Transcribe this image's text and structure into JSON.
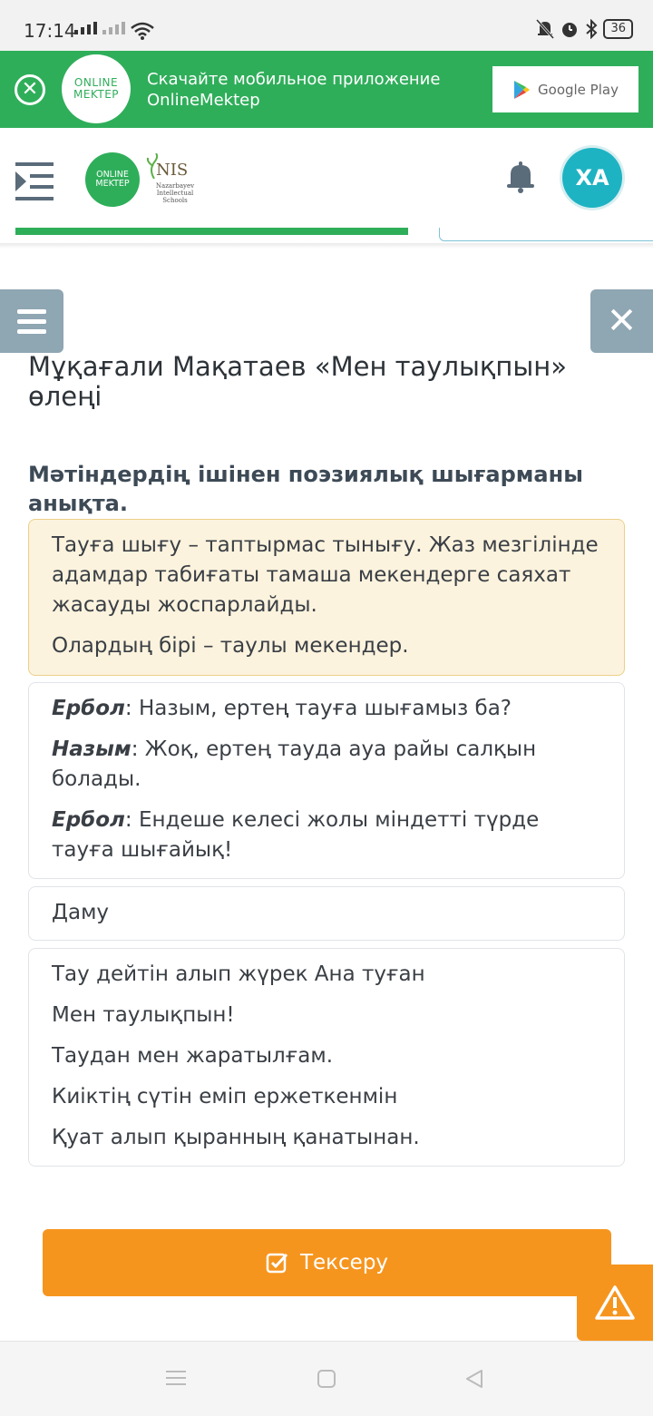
{
  "status_bar": {
    "time": "17:14",
    "battery": "36"
  },
  "banner": {
    "logo_line1": "ONLINE",
    "logo_line2": "MEKTEP",
    "text_line1": "Скачайте мобильное приложение",
    "text_line2": "OnlineMektep",
    "store_label": "Google Play"
  },
  "header": {
    "logo_line1": "ONLINE",
    "logo_line2": "MEKTEP",
    "nis_big": "NIS",
    "nis_small": "Nazarbayev Intellectual Schools",
    "avatar_initials": "ХА"
  },
  "lesson": {
    "title": "Мұқағали Мақатаев «Мен таулықпын» өлеңі",
    "question": "Мәтіндердің ішінен поэзиялық шығарманы анықта."
  },
  "options": [
    {
      "selected": true,
      "paragraphs": [
        "Тауға шығу – таптырмас тынығу. Жаз мезгілінде адамдар табиғаты тамаша мекендерге саяхат жасауды жоспарлайды.",
        "Олардың бірі – таулы мекендер."
      ]
    },
    {
      "selected": false,
      "lines": [
        {
          "speaker": "Ербол",
          "text": ": Назым, ертең тауға шығамыз ба?"
        },
        {
          "speaker": "Назым",
          "text": ": Жоқ, ертең тауда ауа райы салқын болады."
        },
        {
          "speaker": "Ербол",
          "text": ": Ендеше келесі жолы міндетті түрде тауға шығайық!"
        }
      ]
    },
    {
      "selected": false,
      "paragraphs": [
        "Даму"
      ]
    },
    {
      "selected": false,
      "paragraphs": [
        "Тау дейтін алып жүрек Ана туған",
        "Мен таулықпын!",
        "Таудан мен жаратылғам.",
        "Киіктің сүтін еміп ержеткенмін",
        "Қуат алып қыранның қанатынан."
      ]
    }
  ],
  "check_button": {
    "label": "Тексеру"
  },
  "colors": {
    "brand_green": "#2fae5a",
    "accent_orange": "#f6951e",
    "avatar": "#1eb3c3",
    "side_button": "#8fa6b3"
  }
}
